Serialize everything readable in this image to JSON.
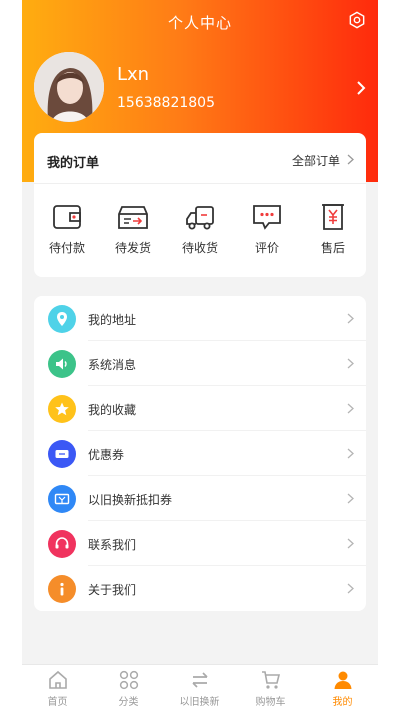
{
  "header": {
    "title": "个人中心",
    "settings_icon": "settings-icon"
  },
  "profile": {
    "name": "Lxn",
    "phone": "15638821805"
  },
  "orders": {
    "title": "我的订单",
    "all_label": "全部订单",
    "statuses": [
      {
        "label": "待付款",
        "icon": "wallet-icon"
      },
      {
        "label": "待发货",
        "icon": "package-icon"
      },
      {
        "label": "待收货",
        "icon": "truck-icon"
      },
      {
        "label": "评价",
        "icon": "comment-icon"
      },
      {
        "label": "售后",
        "icon": "yuan-icon"
      }
    ]
  },
  "menu": {
    "items": [
      {
        "label": "我的地址",
        "icon": "location-icon",
        "color": "#4fd2e8"
      },
      {
        "label": "系统消息",
        "icon": "speaker-icon",
        "color": "#3cc389"
      },
      {
        "label": "我的收藏",
        "icon": "star-icon",
        "color": "#ffc21a"
      },
      {
        "label": "优惠券",
        "icon": "coupon-icon",
        "color": "#3b58f5"
      },
      {
        "label": "以旧换新抵扣券",
        "icon": "voucher-icon",
        "color": "#2f88f6"
      },
      {
        "label": "联系我们",
        "icon": "headset-icon",
        "color": "#f0335e"
      },
      {
        "label": "关于我们",
        "icon": "info-icon",
        "color": "#f58d2a"
      }
    ]
  },
  "tabbar": {
    "items": [
      {
        "label": "首页",
        "icon": "home-icon",
        "active": false
      },
      {
        "label": "分类",
        "icon": "category-icon",
        "active": false
      },
      {
        "label": "以旧换新",
        "icon": "exchange-icon",
        "active": false
      },
      {
        "label": "购物车",
        "icon": "cart-icon",
        "active": false
      },
      {
        "label": "我的",
        "icon": "user-icon",
        "active": true
      }
    ]
  },
  "colors": {
    "accent": "#ff8a00",
    "gradient_start": "#ffad10",
    "gradient_end": "#ff2a0c"
  }
}
